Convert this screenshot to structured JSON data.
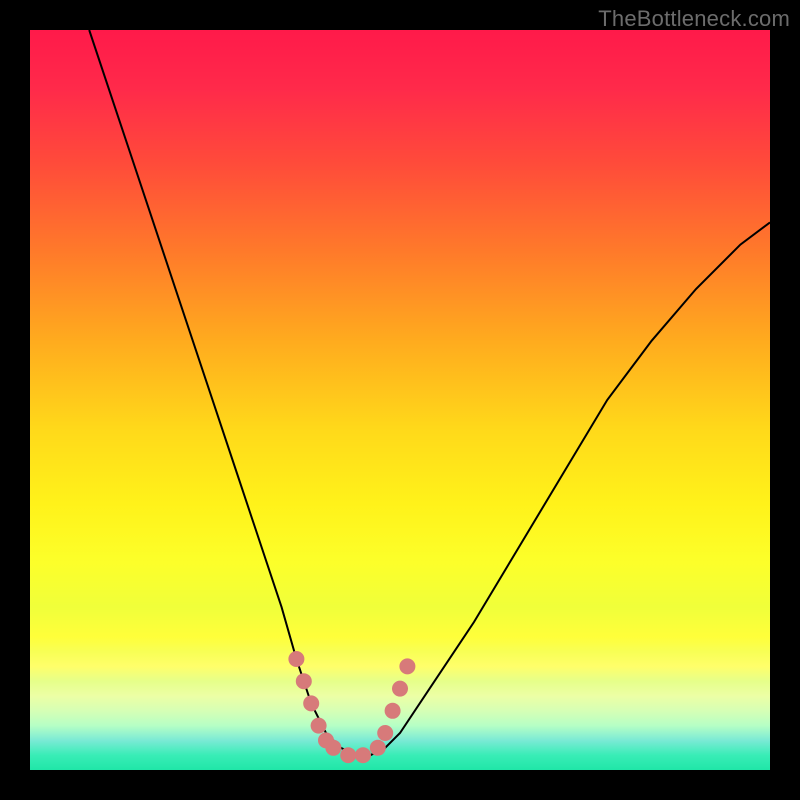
{
  "watermark": "TheBottleneck.com",
  "chart_data": {
    "type": "line",
    "title": "",
    "xlabel": "",
    "ylabel": "",
    "xlim": [
      0,
      100
    ],
    "ylim": [
      0,
      100
    ],
    "grid": false,
    "series": [
      {
        "name": "curve",
        "x": [
          8,
          12,
          16,
          20,
          24,
          28,
          30,
          32,
          34,
          36,
          38,
          40,
          42,
          44,
          46,
          48,
          50,
          54,
          60,
          66,
          72,
          78,
          84,
          90,
          96,
          100
        ],
        "y": [
          100,
          88,
          76,
          64,
          52,
          40,
          34,
          28,
          22,
          15,
          9,
          5,
          3,
          2,
          2,
          3,
          5,
          11,
          20,
          30,
          40,
          50,
          58,
          65,
          71,
          74
        ]
      }
    ],
    "markers": {
      "name": "highlight-dots",
      "color": "#d77a7a",
      "points": [
        {
          "x": 36,
          "y": 15
        },
        {
          "x": 37,
          "y": 12
        },
        {
          "x": 38,
          "y": 9
        },
        {
          "x": 39,
          "y": 6
        },
        {
          "x": 40,
          "y": 4
        },
        {
          "x": 41,
          "y": 3
        },
        {
          "x": 43,
          "y": 2
        },
        {
          "x": 45,
          "y": 2
        },
        {
          "x": 47,
          "y": 3
        },
        {
          "x": 48,
          "y": 5
        },
        {
          "x": 49,
          "y": 8
        },
        {
          "x": 50,
          "y": 11
        },
        {
          "x": 51,
          "y": 14
        }
      ]
    },
    "background_gradient": {
      "top": "#ff1a4a",
      "middle": "#ffe81a",
      "bottom": "#20e6a8"
    }
  }
}
